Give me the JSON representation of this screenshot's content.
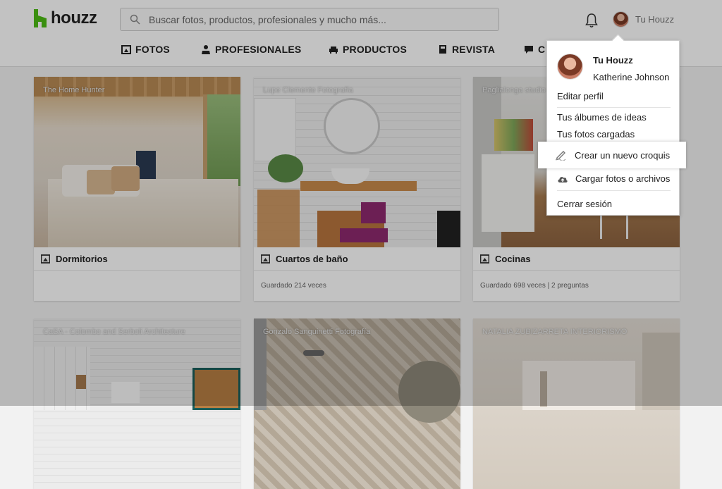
{
  "header": {
    "logo_text": "houzz",
    "search_placeholder": "Buscar fotos, productos, profesionales y mucho más...",
    "user_label": "Tu Houzz"
  },
  "nav": {
    "items": [
      {
        "label": "FOTOS",
        "icon": "photo-icon"
      },
      {
        "label": "PROFESIONALES",
        "icon": "person-icon"
      },
      {
        "label": "PRODUCTOS",
        "icon": "sofa-icon"
      },
      {
        "label": "REVISTA",
        "icon": "book-icon"
      },
      {
        "label": "C",
        "icon": "chat-icon"
      }
    ]
  },
  "cards": [
    {
      "credit": "The Home Hunter",
      "title": "Dormitorios",
      "meta": ""
    },
    {
      "credit": "Lupe Clemente Fotografía",
      "title": "Cuartos de baño",
      "meta": "Guardado 214 veces"
    },
    {
      "credit": "Paglialonga studio",
      "title": "Cocinas",
      "meta": "Guardado 698 veces | 2 preguntas"
    },
    {
      "credit": "CaSA - Colombo and Serboli Architecture",
      "title": "",
      "meta": ""
    },
    {
      "credit": "Gonzalo Sanguinetti Fotografía",
      "title": "",
      "meta": ""
    },
    {
      "credit": "NATALIA ZUBIZARRETA INTERIORISMO",
      "title": "",
      "meta": ""
    }
  ],
  "dropdown": {
    "name": "Tu Houzz",
    "full_name": "Katherine Johnson",
    "edit_profile": "Editar perfil",
    "ideas": "Tus álbumes de ideas",
    "photos": "Tus fotos cargadas",
    "sketch": "Crear un nuevo croquis",
    "upload": "Cargar fotos o archivos",
    "logout": "Cerrar sesión"
  },
  "colors": {
    "brand_green": "#4dbc15",
    "overlay": "rgba(0,0,0,0.24)"
  }
}
